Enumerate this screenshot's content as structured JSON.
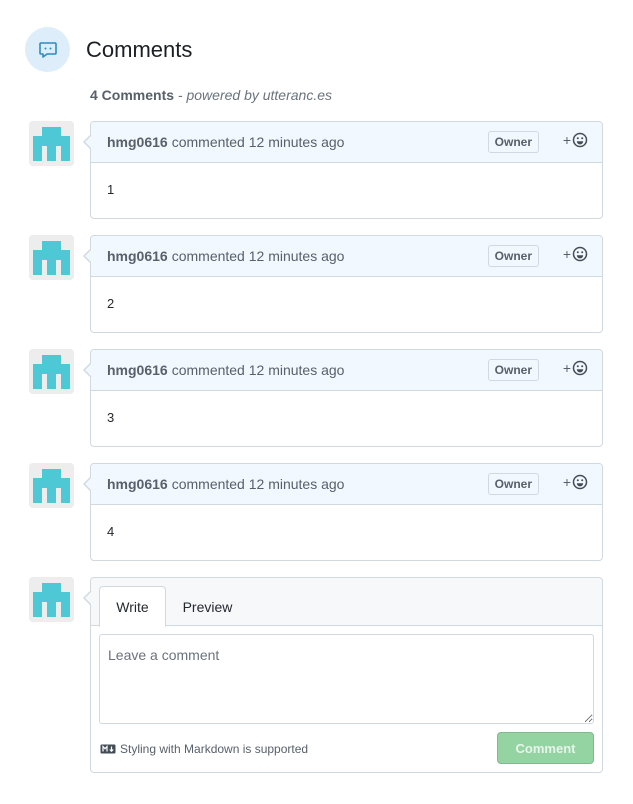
{
  "header": {
    "title": "Comments",
    "icon": "comment-icon",
    "icon_color": "#2f8ac0"
  },
  "summary": {
    "count_text": "4 Comments",
    "powered_text": " - powered by utteranc.es"
  },
  "comments": [
    {
      "author": "hmg0616",
      "time": "commented 12 minutes ago",
      "badge": "Owner",
      "reaction_plus": "+",
      "body": "1"
    },
    {
      "author": "hmg0616",
      "time": "commented 12 minutes ago",
      "badge": "Owner",
      "reaction_plus": "+",
      "body": "2"
    },
    {
      "author": "hmg0616",
      "time": "commented 12 minutes ago",
      "badge": "Owner",
      "reaction_plus": "+",
      "body": "3"
    },
    {
      "author": "hmg0616",
      "time": "commented 12 minutes ago",
      "badge": "Owner",
      "reaction_plus": "+",
      "body": "4"
    }
  ],
  "new_comment": {
    "tab_write": "Write",
    "tab_preview": "Preview",
    "placeholder": "Leave a comment",
    "markdown_note": "Styling with Markdown is supported",
    "submit_label": "Comment"
  },
  "colors": {
    "accent": "#2f8ac0",
    "avatar_identicon": "#4fc8d6",
    "header_bg": "#f1f8ff",
    "submit_disabled": "#94d3a2"
  }
}
